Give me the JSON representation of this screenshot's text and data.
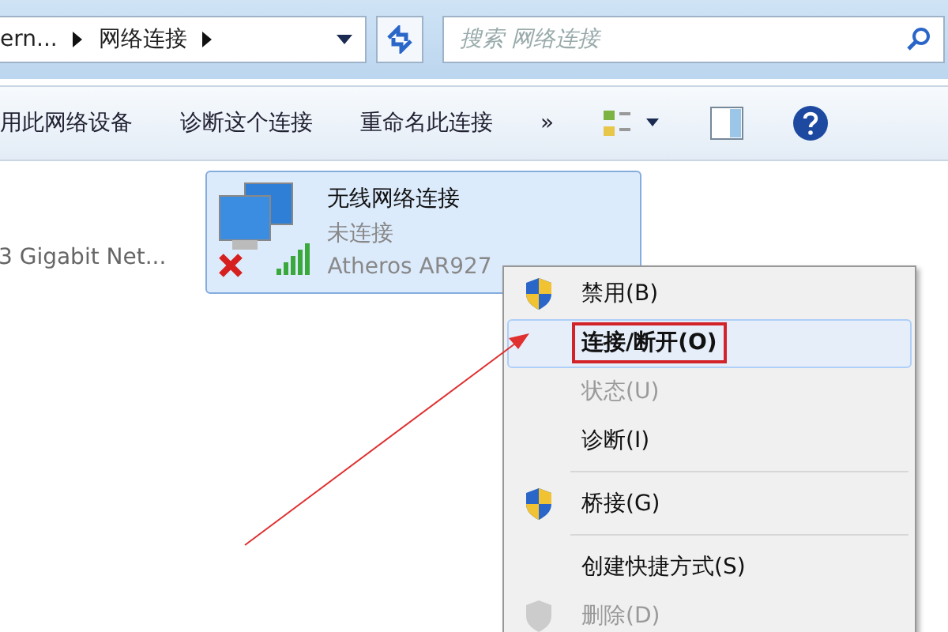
{
  "address_bar": {
    "crumbs": [
      "ern...",
      "网络连接"
    ]
  },
  "search": {
    "placeholder": "搜索 网络连接"
  },
  "toolbar": {
    "items": [
      "用此网络设备",
      "诊断这个连接",
      "重命名此连接",
      "»"
    ]
  },
  "connections": [
    {
      "name": "3 Gigabit Net...",
      "selected": false
    },
    {
      "name": "无线网络连接",
      "selected": true,
      "lines": [
        "未连接",
        "Atheros AR927"
      ]
    }
  ],
  "context_menu": {
    "items": [
      {
        "kind": "item",
        "label": "禁用(B)",
        "shield": true,
        "disabled": false,
        "selected": false,
        "annotated": false
      },
      {
        "kind": "item",
        "label": "连接/断开(O)",
        "shield": false,
        "disabled": false,
        "selected": true,
        "annotated": true
      },
      {
        "kind": "item",
        "label": "状态(U)",
        "shield": false,
        "disabled": true,
        "selected": false,
        "annotated": false
      },
      {
        "kind": "item",
        "label": "诊断(I)",
        "shield": false,
        "disabled": false,
        "selected": false,
        "annotated": false
      },
      {
        "kind": "separator"
      },
      {
        "kind": "item",
        "label": "桥接(G)",
        "shield": true,
        "disabled": false,
        "selected": false,
        "annotated": false
      },
      {
        "kind": "separator"
      },
      {
        "kind": "item",
        "label": "创建快捷方式(S)",
        "shield": false,
        "disabled": false,
        "selected": false,
        "annotated": false
      },
      {
        "kind": "item",
        "label": "删除(D)",
        "shield": true,
        "disabled": true,
        "selected": false,
        "annotated": false
      }
    ]
  }
}
